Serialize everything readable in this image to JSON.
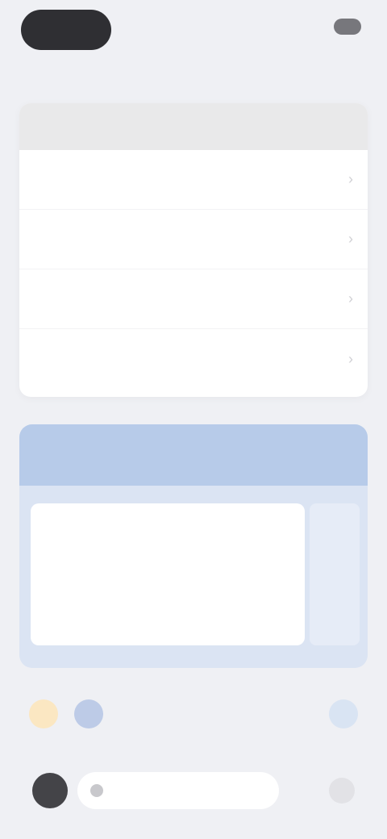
{
  "topbar": {
    "left_label": "",
    "right_text": ""
  },
  "card": {
    "title": "",
    "rows": [
      {
        "label": ""
      },
      {
        "label": ""
      },
      {
        "label": ""
      },
      {
        "label": ""
      }
    ]
  },
  "panel": {
    "title": "",
    "subtitle": "",
    "tag": "",
    "text": ""
  },
  "bottom": {
    "search_placeholder": ""
  },
  "colors": {
    "background": "#eff0f4",
    "panel_header": "#b7cbe9",
    "panel_bg": "#dbe4f3",
    "accent_pink": "#e05bc8",
    "dark_pill": "#2f2f33"
  }
}
